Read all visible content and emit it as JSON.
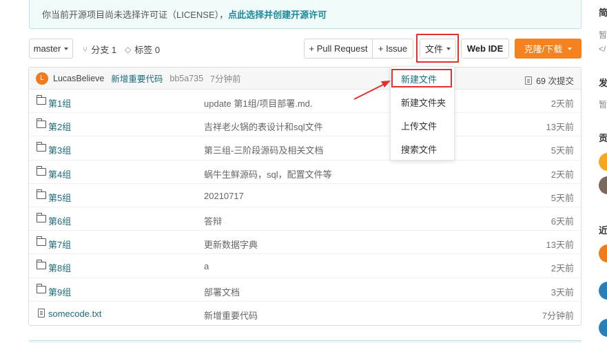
{
  "license_notice": {
    "text": "你当前开源项目尚未选择许可证（LICENSE），",
    "link": "点此选择并创建开源许可"
  },
  "toolbar": {
    "branch_select": "master",
    "branch_count": "分支 1",
    "tag_count": "标签 0",
    "pull_request": "+ Pull Request",
    "issue": "+ Issue",
    "file_menu": "文件",
    "web_ide": "Web IDE",
    "clone": "克隆/下载"
  },
  "latest_commit": {
    "avatar_letter": "L",
    "author": "LucasBelieve",
    "message": "新增重要代码",
    "hash": "bb5a735",
    "time": "7分钟前",
    "commit_count": "69 次提交"
  },
  "files": [
    {
      "name": "第1组",
      "type": "folder",
      "message": "update 第1组/项目部署.md.",
      "age": "2天前"
    },
    {
      "name": "第2组",
      "type": "folder",
      "message": "吉祥老火锅的表设计和sql文件",
      "age": "13天前"
    },
    {
      "name": "第3组",
      "type": "folder",
      "message": "第三组-三阶段源码及相关文档",
      "age": "5天前"
    },
    {
      "name": "第4组",
      "type": "folder",
      "message": "蜗牛生鲜源码，sql，配置文件等",
      "age": "2天前"
    },
    {
      "name": "第5组",
      "type": "folder",
      "message": "20210717",
      "age": "5天前"
    },
    {
      "name": "第6组",
      "type": "folder",
      "message": "答辩",
      "age": "6天前"
    },
    {
      "name": "第7组",
      "type": "folder",
      "message": "更新数据字典",
      "age": "13天前"
    },
    {
      "name": "第8组",
      "type": "folder",
      "message": "a",
      "age": "2天前"
    },
    {
      "name": "第9组",
      "type": "folder",
      "message": "部署文档",
      "age": "3天前"
    },
    {
      "name": "somecode.txt",
      "type": "file",
      "message": "新增重要代码",
      "age": "7分钟前"
    }
  ],
  "file_dropdown": {
    "items": [
      "新建文件",
      "新建文件夹",
      "上传文件",
      "搜索文件"
    ]
  },
  "right_panel": {
    "t1": "简",
    "s1": "暂",
    "s2": "</",
    "t2": "发",
    "s3": "暂",
    "t3": "贡",
    "t4": "近"
  },
  "colors": {
    "accent": "#1a6c7a",
    "clone_button": "#f5821f",
    "highlight": "#e03131"
  }
}
